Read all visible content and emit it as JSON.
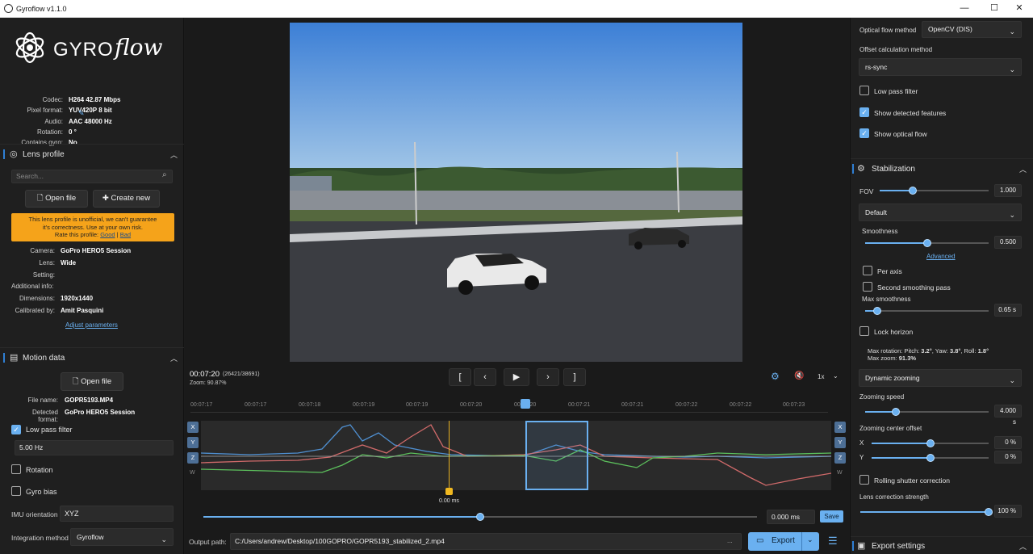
{
  "window": {
    "title": "Gyroflow v1.1.0"
  },
  "logo": {
    "text_a": "GYRO",
    "text_b": "flow"
  },
  "file_info": [
    {
      "label": "Codec:",
      "value": "H264 42.87 Mbps"
    },
    {
      "label": "Pixel format:",
      "value": "YUV420P 8 bit"
    },
    {
      "label": "Audio:",
      "value": "AAC 48000 Hz"
    },
    {
      "label": "Rotation:",
      "value": "0 °"
    },
    {
      "label": "Contains gyro:",
      "value": "No"
    }
  ],
  "lens_profile": {
    "title": "Lens profile",
    "search_placeholder": "Search...",
    "open_file": "Open file",
    "create_new": "Create new",
    "warning_line1": "This lens profile is unofficial, we can't guarantee",
    "warning_line2": "it's correctness. Use at your own risk.",
    "warning_line3": "Rate this profile:",
    "rate_good": "Good",
    "rate_sep": "|",
    "rate_bad": "Bad",
    "fields": [
      {
        "label": "Camera:",
        "value": "GoPro HERO5 Session"
      },
      {
        "label": "Lens:",
        "value": "Wide"
      },
      {
        "label": "Setting:",
        "value": ""
      },
      {
        "label": "Additional info:",
        "value": ""
      },
      {
        "label": "Dimensions:",
        "value": "1920x1440"
      },
      {
        "label": "Calibrated by:",
        "value": "Amit Pasquini"
      }
    ],
    "adjust": "Adjust parameters"
  },
  "motion_data": {
    "title": "Motion data",
    "open_file": "Open file",
    "file_name_label": "File name:",
    "file_name": "GOPR5193.MP4",
    "detected_label": "Detected format:",
    "detected": "GoPro HERO5 Session",
    "low_pass_label": "Low pass filter",
    "low_pass_value": "5.00 Hz",
    "rotation_label": "Rotation",
    "gyro_bias_label": "Gyro bias",
    "imu_label": "IMU orientation",
    "imu_value": "XYZ",
    "integration_label": "Integration method",
    "integration_value": "Gyroflow"
  },
  "player": {
    "time": "00:07:20",
    "frames": "(26421/38691)",
    "zoom": "Zoom: 90.87%",
    "speed": "1x",
    "btn_start": "[",
    "btn_prev": "‹",
    "btn_play": "▶",
    "btn_next": "›",
    "btn_end": "]"
  },
  "timeline": {
    "ticks": [
      "00:07:17",
      "00:07:17",
      "00:07:18",
      "00:07:19",
      "00:07:19",
      "00:07:20",
      "00:07:20",
      "00:07:21",
      "00:07:21",
      "00:07:22",
      "00:07:22",
      "00:07:23"
    ],
    "axes": [
      "X",
      "Y",
      "Z",
      "W"
    ],
    "marker_label": "0.00 ms",
    "offset_value": "0.000 ms",
    "save": "Save"
  },
  "output": {
    "label": "Output path:",
    "path": "C:/Users/andrew/Desktop/100GOPRO/GOPR5193_stabilized_2.mp4",
    "dots": "...",
    "export": "Export"
  },
  "right": {
    "flow_method_label": "Optical flow method",
    "flow_method_value": "OpenCV (DIS)",
    "offset_method_label": "Offset calculation method",
    "offset_method_value": "rs-sync",
    "lpf_label": "Low pass filter",
    "show_features": "Show detected features",
    "show_flow": "Show optical flow",
    "stab_title": "Stabilization",
    "fov_label": "FOV",
    "fov_value": "1.000",
    "fov_level": 0.3,
    "algo_value": "Default",
    "smooth_label": "Smoothness",
    "smooth_value": "0.500",
    "smooth_level": 0.5,
    "advanced": "Advanced",
    "per_axis": "Per axis",
    "second_pass": "Second smoothing pass",
    "max_smooth_label": "Max smoothness",
    "max_smooth_value": "0.65 s",
    "max_smooth_level": 0.1,
    "lock_horizon": "Lock horizon",
    "max_rot_prefix": "Max rotation: Pitch: ",
    "max_rot_pitch": "3.2°",
    "max_rot_yaw_lbl": ", Yaw: ",
    "max_rot_yaw": "3.8°",
    "max_rot_roll_lbl": ", Roll: ",
    "max_rot_roll": "1.8°",
    "max_zoom_lbl": "Max zoom: ",
    "max_zoom": "91.3%",
    "zoom_mode": "Dynamic zooming",
    "zoom_speed_label": "Zooming speed",
    "zoom_speed_value": "4.000 s",
    "zoom_speed_level": 0.25,
    "zoom_center_label": "Zooming center offset",
    "x_label": "X",
    "x_value": "0 %",
    "x_level": 0.5,
    "y_label": "Y",
    "y_value": "0 %",
    "y_level": 0.5,
    "rolling_shutter": "Rolling shutter correction",
    "lens_strength_label": "Lens correction strength",
    "lens_strength_value": "100 %",
    "lens_strength_level": 1.0,
    "export_settings": "Export settings"
  },
  "colors": {
    "accent": "#6ab0f0",
    "warning": "#f5a31a",
    "panel": "#1f1f1f"
  }
}
